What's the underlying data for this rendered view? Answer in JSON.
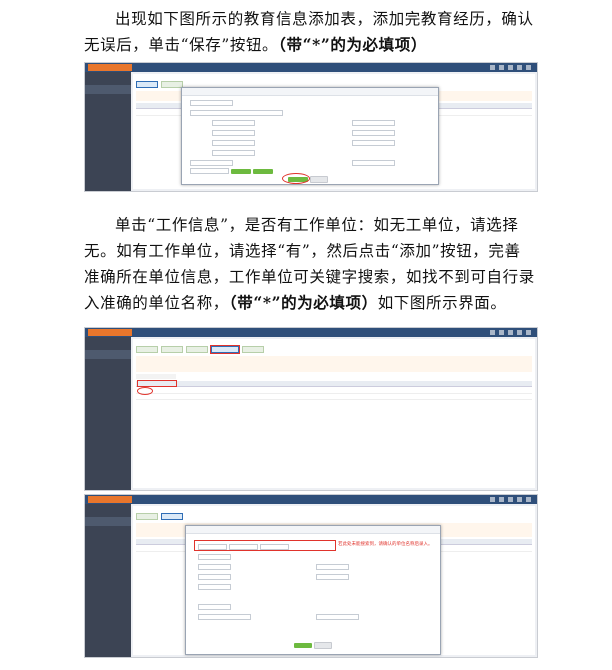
{
  "paragraph1": {
    "part1": "出现如下图所示的教育信息添加表，添加完教育经历，确认无误后，单击“保存”按钮。",
    "bold": "（带“*”的为必填项）"
  },
  "paragraph2": {
    "part1": "单击“工作信息”，是否有工作单位：如无工单位，请选择无。如有工作单位，请选择“有”，然后点击“添加”按钮，完善准确所在单位信息，工作单位可关键字搜索，如找不到可自行录入准确的单位名称，",
    "bold": "（带“*”的为必填项）",
    "part2": "如下图所示界面。"
  },
  "screenshot3": {
    "annotation": "若此处未能搜索到，请确认的单位名称后录入。"
  }
}
